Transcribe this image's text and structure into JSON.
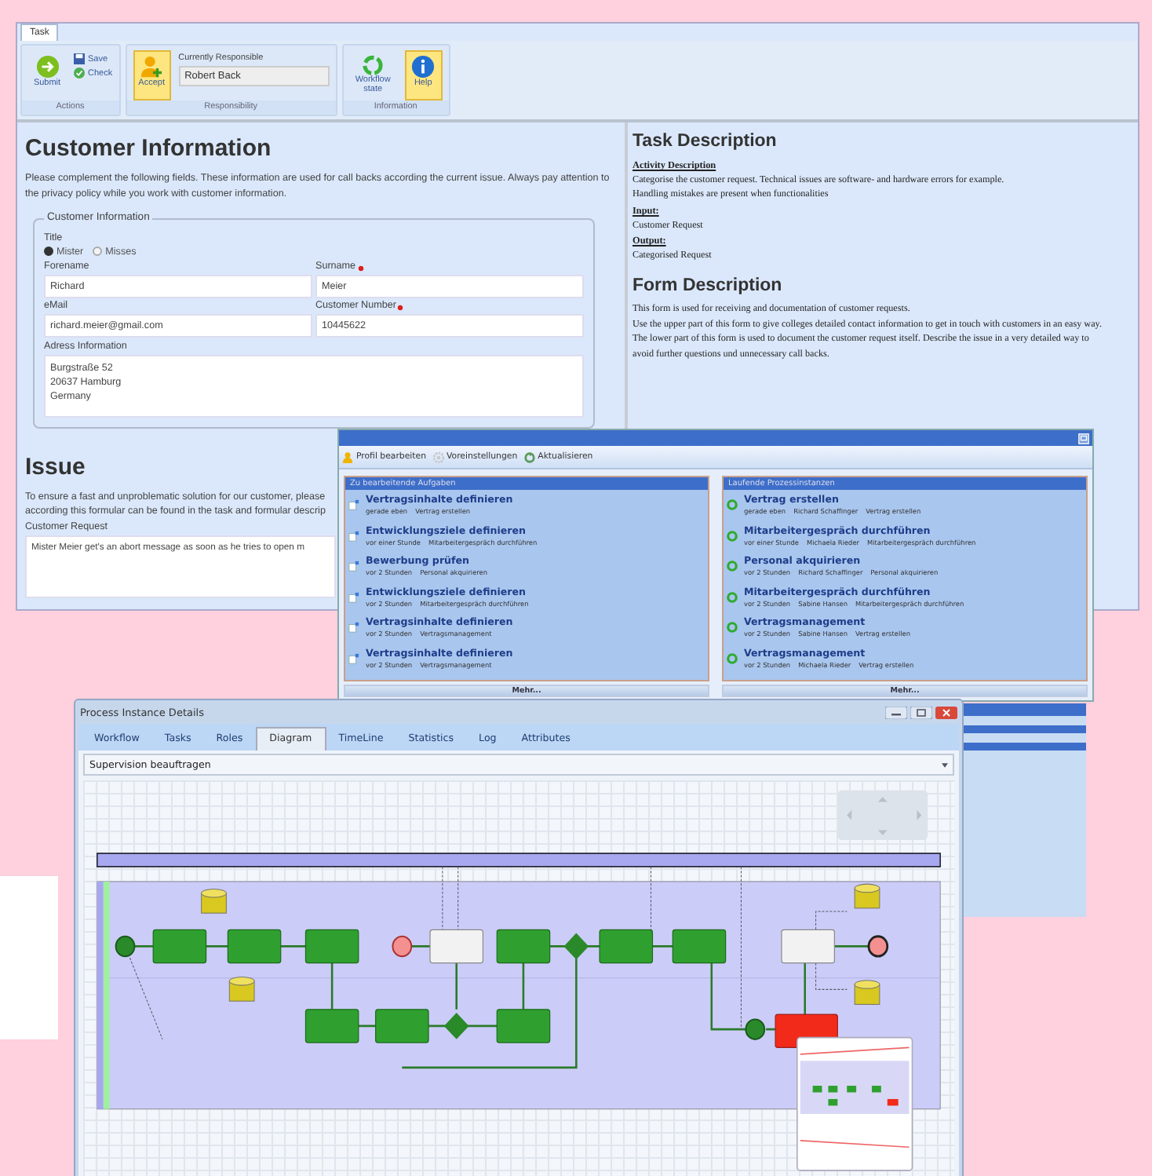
{
  "task_window": {
    "tabs": [
      {
        "label": "Task",
        "selected": true
      }
    ],
    "ribbon": {
      "actions": {
        "label": "Actions",
        "submit": {
          "label": "Submit",
          "highlighted": false
        },
        "save": "Save",
        "check": "Check"
      },
      "responsibility": {
        "label": "Responsibility",
        "accept": {
          "label": "Accept",
          "highlighted": true
        },
        "field_label": "Currently Responsible",
        "responsible": "Robert Back"
      },
      "information": {
        "label": "Information",
        "workflow": {
          "label": "Workflow state",
          "highlighted": false
        },
        "help": {
          "label": "Help",
          "highlighted": true
        }
      }
    },
    "customer_form": {
      "heading": "Customer Information",
      "intro": "Please complement the following fields. These information are used for call backs according the current issue. Always pay attention to the privacy policy while you work with customer information.",
      "legend": "Customer Information",
      "title_label": "Title",
      "title_options": [
        {
          "label": "Mister",
          "selected": true
        },
        {
          "label": "Misses",
          "selected": false
        }
      ],
      "fields": [
        {
          "label": "Forename",
          "required": false,
          "value": "Richard"
        },
        {
          "label": "Surname",
          "required": true,
          "value": "Meier"
        },
        {
          "label": "eMail",
          "required": false,
          "value": "richard.meier@gmail.com"
        },
        {
          "label": "Customer Number",
          "required": true,
          "value": "10445622"
        }
      ],
      "address": {
        "label": "Adress Information",
        "lines": [
          "Burgstraße 52",
          "20637 Hamburg",
          "Germany"
        ]
      }
    },
    "issue": {
      "heading": "Issue",
      "intro_lines": [
        "To ensure a fast and unproblematic solution for our customer, please",
        "according this formular can be found in the task and formular descrip"
      ],
      "request_label": "Customer Request",
      "request_value": "Mister Meier get's an abort message as soon as he tries to open m"
    },
    "task_description": {
      "heading": "Task Description",
      "sections": [
        {
          "title": "Activity Description",
          "lines": [
            "Categorise the customer request. Technical issues are software- and hardware errors for example.",
            "Handling mistakes are present when functionalities"
          ]
        },
        {
          "title": "Input:",
          "lines": [
            "Customer Request"
          ]
        },
        {
          "title": "Output:",
          "lines": [
            "Categorised Request"
          ]
        }
      ]
    },
    "form_description": {
      "heading": "Form Description",
      "lines": [
        "This form is used for receiving and documentation of customer requests.",
        "Use the upper part of this form to give colleges detailed contact information to get in touch with customers in an easy way.",
        "The lower part of this form is used to document the customer request itself. Describe the issue in a very detailed way to",
        "avoid further questions und unnecessary call backs."
      ]
    }
  },
  "dashboard_window": {
    "toolbar": [
      "Profil bearbeiten",
      "Voreinstellungen",
      "Aktualisieren"
    ],
    "panels": [
      {
        "title": "Zu bearbeitende Aufgaben",
        "kind": "tasks",
        "more": "Mehr...",
        "items": [
          {
            "title": "Vertragsinhalte definieren",
            "meta": [
              "gerade eben",
              "Vertrag erstellen"
            ]
          },
          {
            "title": "Entwicklungsziele definieren",
            "meta": [
              "vor einer Stunde",
              "Mitarbeitergespräch durchführen"
            ]
          },
          {
            "title": "Bewerbung prüfen",
            "meta": [
              "vor 2 Stunden",
              "Personal akquirieren"
            ]
          },
          {
            "title": "Entwicklungsziele definieren",
            "meta": [
              "vor 2 Stunden",
              "Mitarbeitergespräch durchführen"
            ]
          },
          {
            "title": "Vertragsinhalte definieren",
            "meta": [
              "vor 2 Stunden",
              "Vertragsmanagement"
            ]
          },
          {
            "title": "Vertragsinhalte definieren",
            "meta": [
              "vor 2 Stunden",
              "Vertragsmanagement"
            ]
          }
        ]
      },
      {
        "title": "Laufende Prozessinstanzen",
        "kind": "processes",
        "more": "Mehr...",
        "items": [
          {
            "title": "Vertrag erstellen",
            "meta": [
              "gerade eben",
              "Richard Schaffinger",
              "Vertrag erstellen"
            ]
          },
          {
            "title": "Mitarbeitergespräch durchführen",
            "meta": [
              "vor einer Stunde",
              "Michaela Rieder",
              "Mitarbeitergespräch durchführen"
            ]
          },
          {
            "title": "Personal akquirieren",
            "meta": [
              "vor 2 Stunden",
              "Richard Schaffinger",
              "Personal akquirieren"
            ]
          },
          {
            "title": "Mitarbeitergespräch durchführen",
            "meta": [
              "vor 2 Stunden",
              "Sabine Hansen",
              "Mitarbeitergespräch durchführen"
            ]
          },
          {
            "title": "Vertragsmanagement",
            "meta": [
              "vor 2 Stunden",
              "Sabine Hansen",
              "Vertrag erstellen"
            ]
          },
          {
            "title": "Vertragsmanagement",
            "meta": [
              "vor 2 Stunden",
              "Michaela Rieder",
              "Vertrag erstellen"
            ]
          }
        ]
      }
    ]
  },
  "details_window": {
    "title": "Process Instance Details",
    "tabs": [
      {
        "label": "Workflow",
        "selected": false
      },
      {
        "label": "Tasks",
        "selected": false
      },
      {
        "label": "Roles",
        "selected": false
      },
      {
        "label": "Diagram",
        "selected": true
      },
      {
        "label": "TimeLine",
        "selected": false
      },
      {
        "label": "Statistics",
        "selected": false
      },
      {
        "label": "Log",
        "selected": false
      },
      {
        "label": "Attributes",
        "selected": false
      }
    ],
    "process_select": "Supervision beauftragen"
  }
}
